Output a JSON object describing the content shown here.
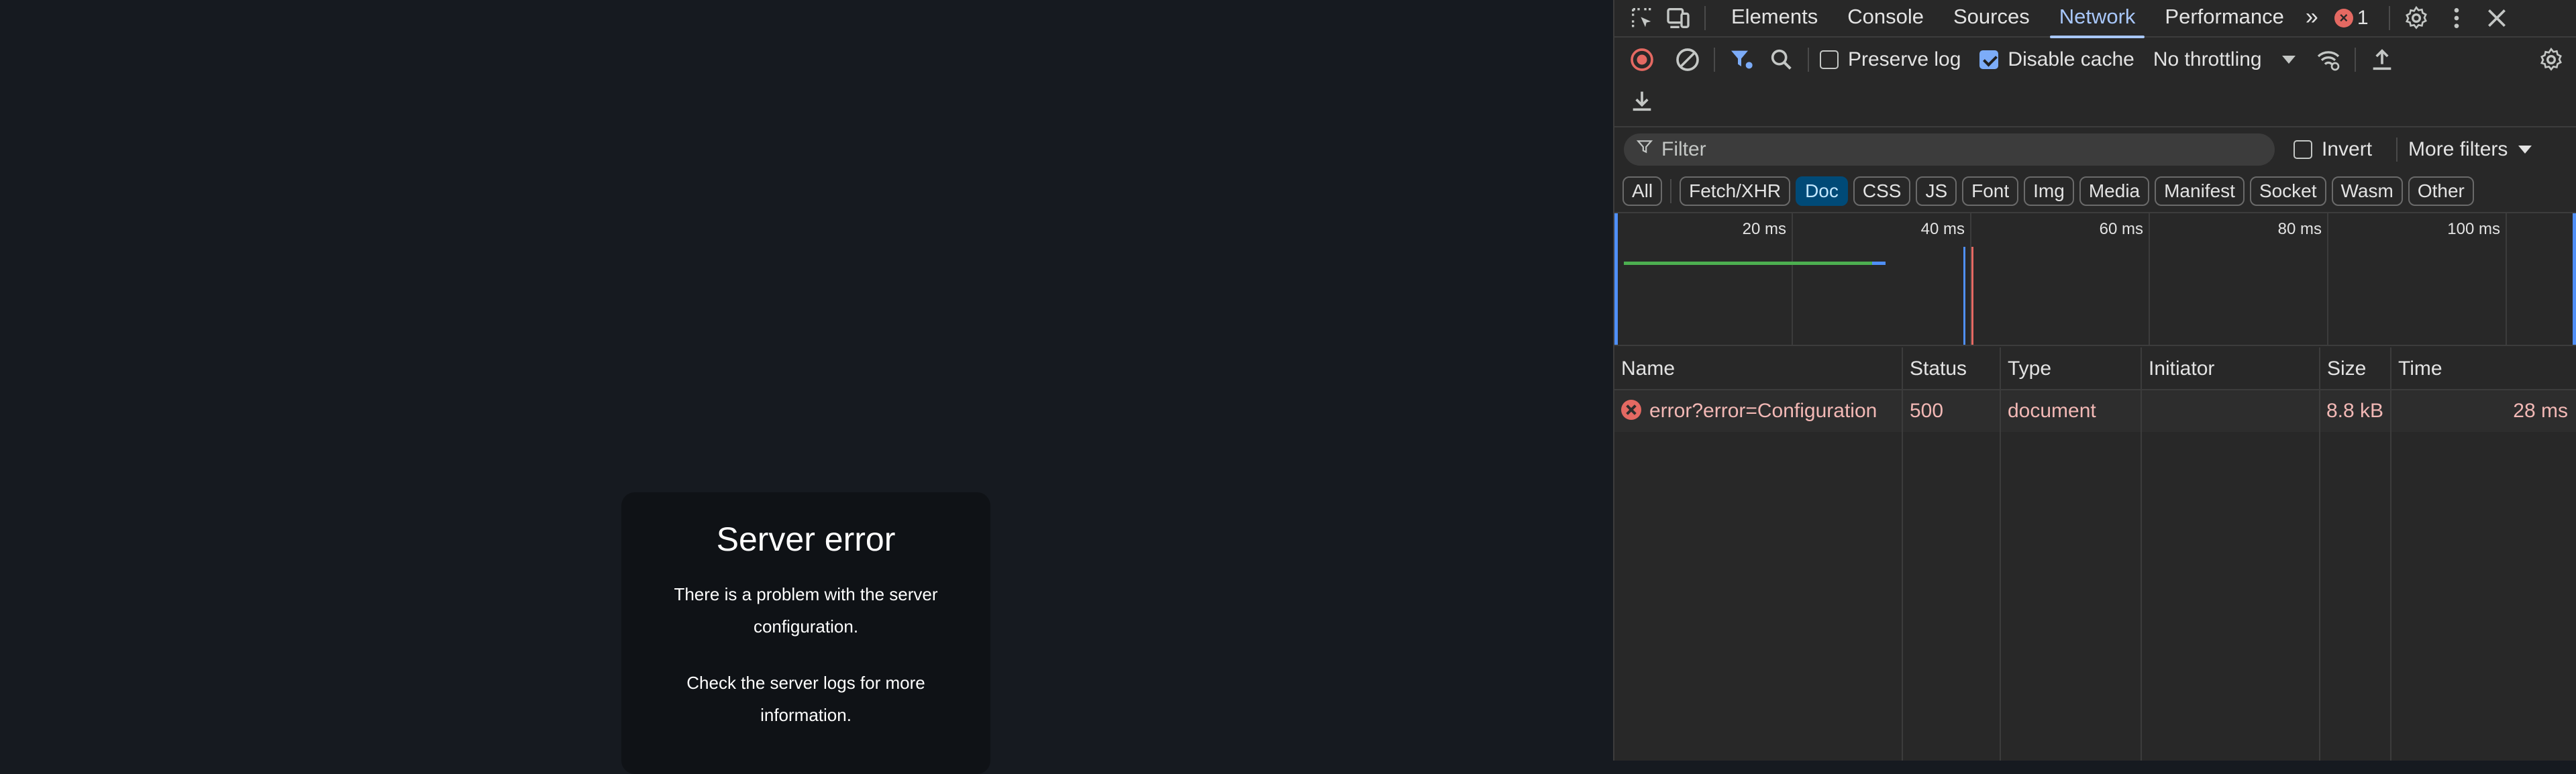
{
  "page": {
    "error_title": "Server error",
    "error_message_1": "There is a problem with the server configuration.",
    "error_message_2": "Check the server logs for more information."
  },
  "devtools": {
    "tabs": [
      "Elements",
      "Console",
      "Sources",
      "Network",
      "Performance"
    ],
    "active_tab": "Network",
    "more_tabs_glyph": "»",
    "error_count": "1",
    "toolbar": {
      "preserve_log": "Preserve log",
      "preserve_log_checked": false,
      "disable_cache": "Disable cache",
      "disable_cache_checked": true,
      "throttling": "No throttling"
    },
    "filter": {
      "placeholder": "Filter",
      "invert": "Invert",
      "more_filters": "More filters"
    },
    "type_chips": [
      "All",
      "Fetch/XHR",
      "Doc",
      "CSS",
      "JS",
      "Font",
      "Img",
      "Media",
      "Manifest",
      "Socket",
      "Wasm",
      "Other"
    ],
    "active_chip": "Doc",
    "timeline_ticks": [
      "20 ms",
      "40 ms",
      "60 ms",
      "80 ms",
      "100 ms"
    ],
    "columns": [
      "Name",
      "Status",
      "Type",
      "Initiator",
      "Size",
      "Time"
    ],
    "requests": [
      {
        "name": "error?error=Configuration",
        "status": "500",
        "type": "document",
        "initiator": "",
        "size": "8.8 kB",
        "time": "28 ms"
      }
    ],
    "colors": {
      "active_tab": "#a8c7fa",
      "error": "#e46962",
      "error_text": "#f2b8b5",
      "waiting_bar": "#4caf50",
      "download_bar": "#4f8ff7"
    }
  }
}
